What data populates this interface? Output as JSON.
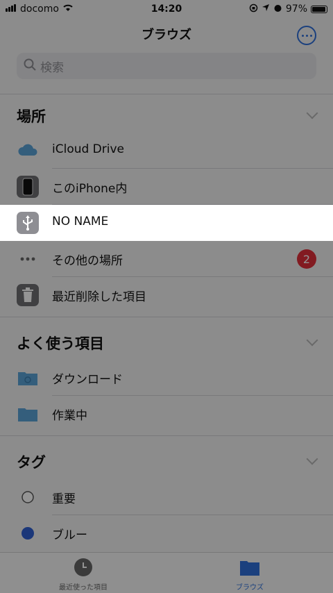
{
  "status": {
    "carrier": "docomo",
    "time": "14:20",
    "battery": "97%",
    "battery_level": 0.97
  },
  "nav": {
    "title": "ブラウズ"
  },
  "search": {
    "placeholder": "検索"
  },
  "sections": {
    "places": "場所",
    "favorites": "よく使う項目",
    "tags": "タグ"
  },
  "places": [
    {
      "label": "iCloud Drive",
      "icon": "icloud-icon"
    },
    {
      "label": "このiPhone内",
      "icon": "iphone-icon"
    },
    {
      "label": "NO NAME",
      "icon": "usb-icon"
    },
    {
      "label": "その他の場所",
      "icon": "more-dots-icon",
      "badge": "2"
    },
    {
      "label": "最近削除した項目",
      "icon": "trash-icon"
    }
  ],
  "favorites": [
    {
      "label": "ダウンロード",
      "icon": "download-folder-icon"
    },
    {
      "label": "作業中",
      "icon": "folder-icon"
    }
  ],
  "tags": [
    {
      "label": "重要",
      "color": "#ffffff"
    },
    {
      "label": "ブルー",
      "color": "#2f5fd0"
    }
  ],
  "tabs": [
    {
      "label": "最近使った項目",
      "icon": "clock-icon"
    },
    {
      "label": "ブラウズ",
      "icon": "folder-icon"
    }
  ],
  "colors": {
    "accent": "#2f6fd9",
    "badge": "#e0303a",
    "folder": "#5aa3d6"
  }
}
